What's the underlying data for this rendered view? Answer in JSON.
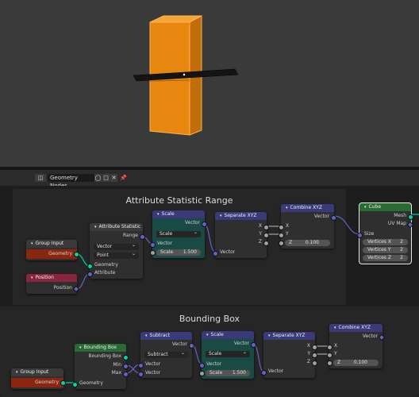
{
  "header": {
    "editor_icon": "node-tree-icon",
    "tree_name": "Geometry Nodes",
    "users_count": "",
    "pin_icon": "pin-icon"
  },
  "frames": {
    "top_title": "Attribute Statistic Range",
    "bottom_title": "Bounding Box"
  },
  "top": {
    "group_input": {
      "title": "Group Input",
      "geometry": "Geometry"
    },
    "position": {
      "title": "Position",
      "output": "Position"
    },
    "attr_stat": {
      "title": "Attribute Statistic",
      "range": "Range",
      "type": "Vector",
      "domain": "Point",
      "geometry": "Geometry",
      "attribute": "Attribute"
    },
    "scale": {
      "title": "Scale",
      "vector_out": "Vector",
      "mode": "Scale",
      "vector_in": "Vector",
      "scale_label": "Scale",
      "scale_value": "1.500"
    },
    "separate": {
      "title": "Separate XYZ",
      "x": "X",
      "y": "Y",
      "z": "Z",
      "vector": "Vector"
    },
    "combine": {
      "title": "Combine XYZ",
      "vector": "Vector",
      "x": "X",
      "y": "Y",
      "z_label": "Z",
      "z_value": "0.100"
    },
    "cube": {
      "title": "Cube",
      "mesh": "Mesh",
      "uv": "UV Map",
      "size": "Size",
      "vx": "Vertices X",
      "vy": "Vertices Y",
      "vz": "Vertices Z",
      "vx_val": "2",
      "vy_val": "2",
      "vz_val": "2"
    }
  },
  "bottom": {
    "group_input": {
      "title": "Group Input",
      "geometry": "Geometry"
    },
    "bbox": {
      "title": "Bounding Box",
      "bbox_out": "Bounding Box",
      "min": "Min",
      "max": "Max",
      "geometry": "Geometry"
    },
    "subtract": {
      "title": "Subtract",
      "vector_out": "Vector",
      "mode": "Subtract",
      "vector_a": "Vector",
      "vector_b": "Vector"
    },
    "scale": {
      "title": "Scale",
      "vector_out": "Vector",
      "mode": "Scale",
      "vector_in": "Vector",
      "scale_label": "Scale",
      "scale_value": "1.500"
    },
    "separate": {
      "title": "Separate XYZ",
      "x": "X",
      "y": "Y",
      "z": "Z",
      "vector": "Vector"
    },
    "combine": {
      "title": "Combine XYZ",
      "vector": "Vector",
      "x": "X",
      "y": "Y",
      "z_label": "Z",
      "z_value": "0.100"
    }
  },
  "colors": {
    "viewport_bg": "#3a3a3a",
    "object_orange": "#e8870f",
    "socket_geometry": "#00d6a3",
    "socket_vector": "#6363c7",
    "socket_float": "#a1a1a1"
  }
}
